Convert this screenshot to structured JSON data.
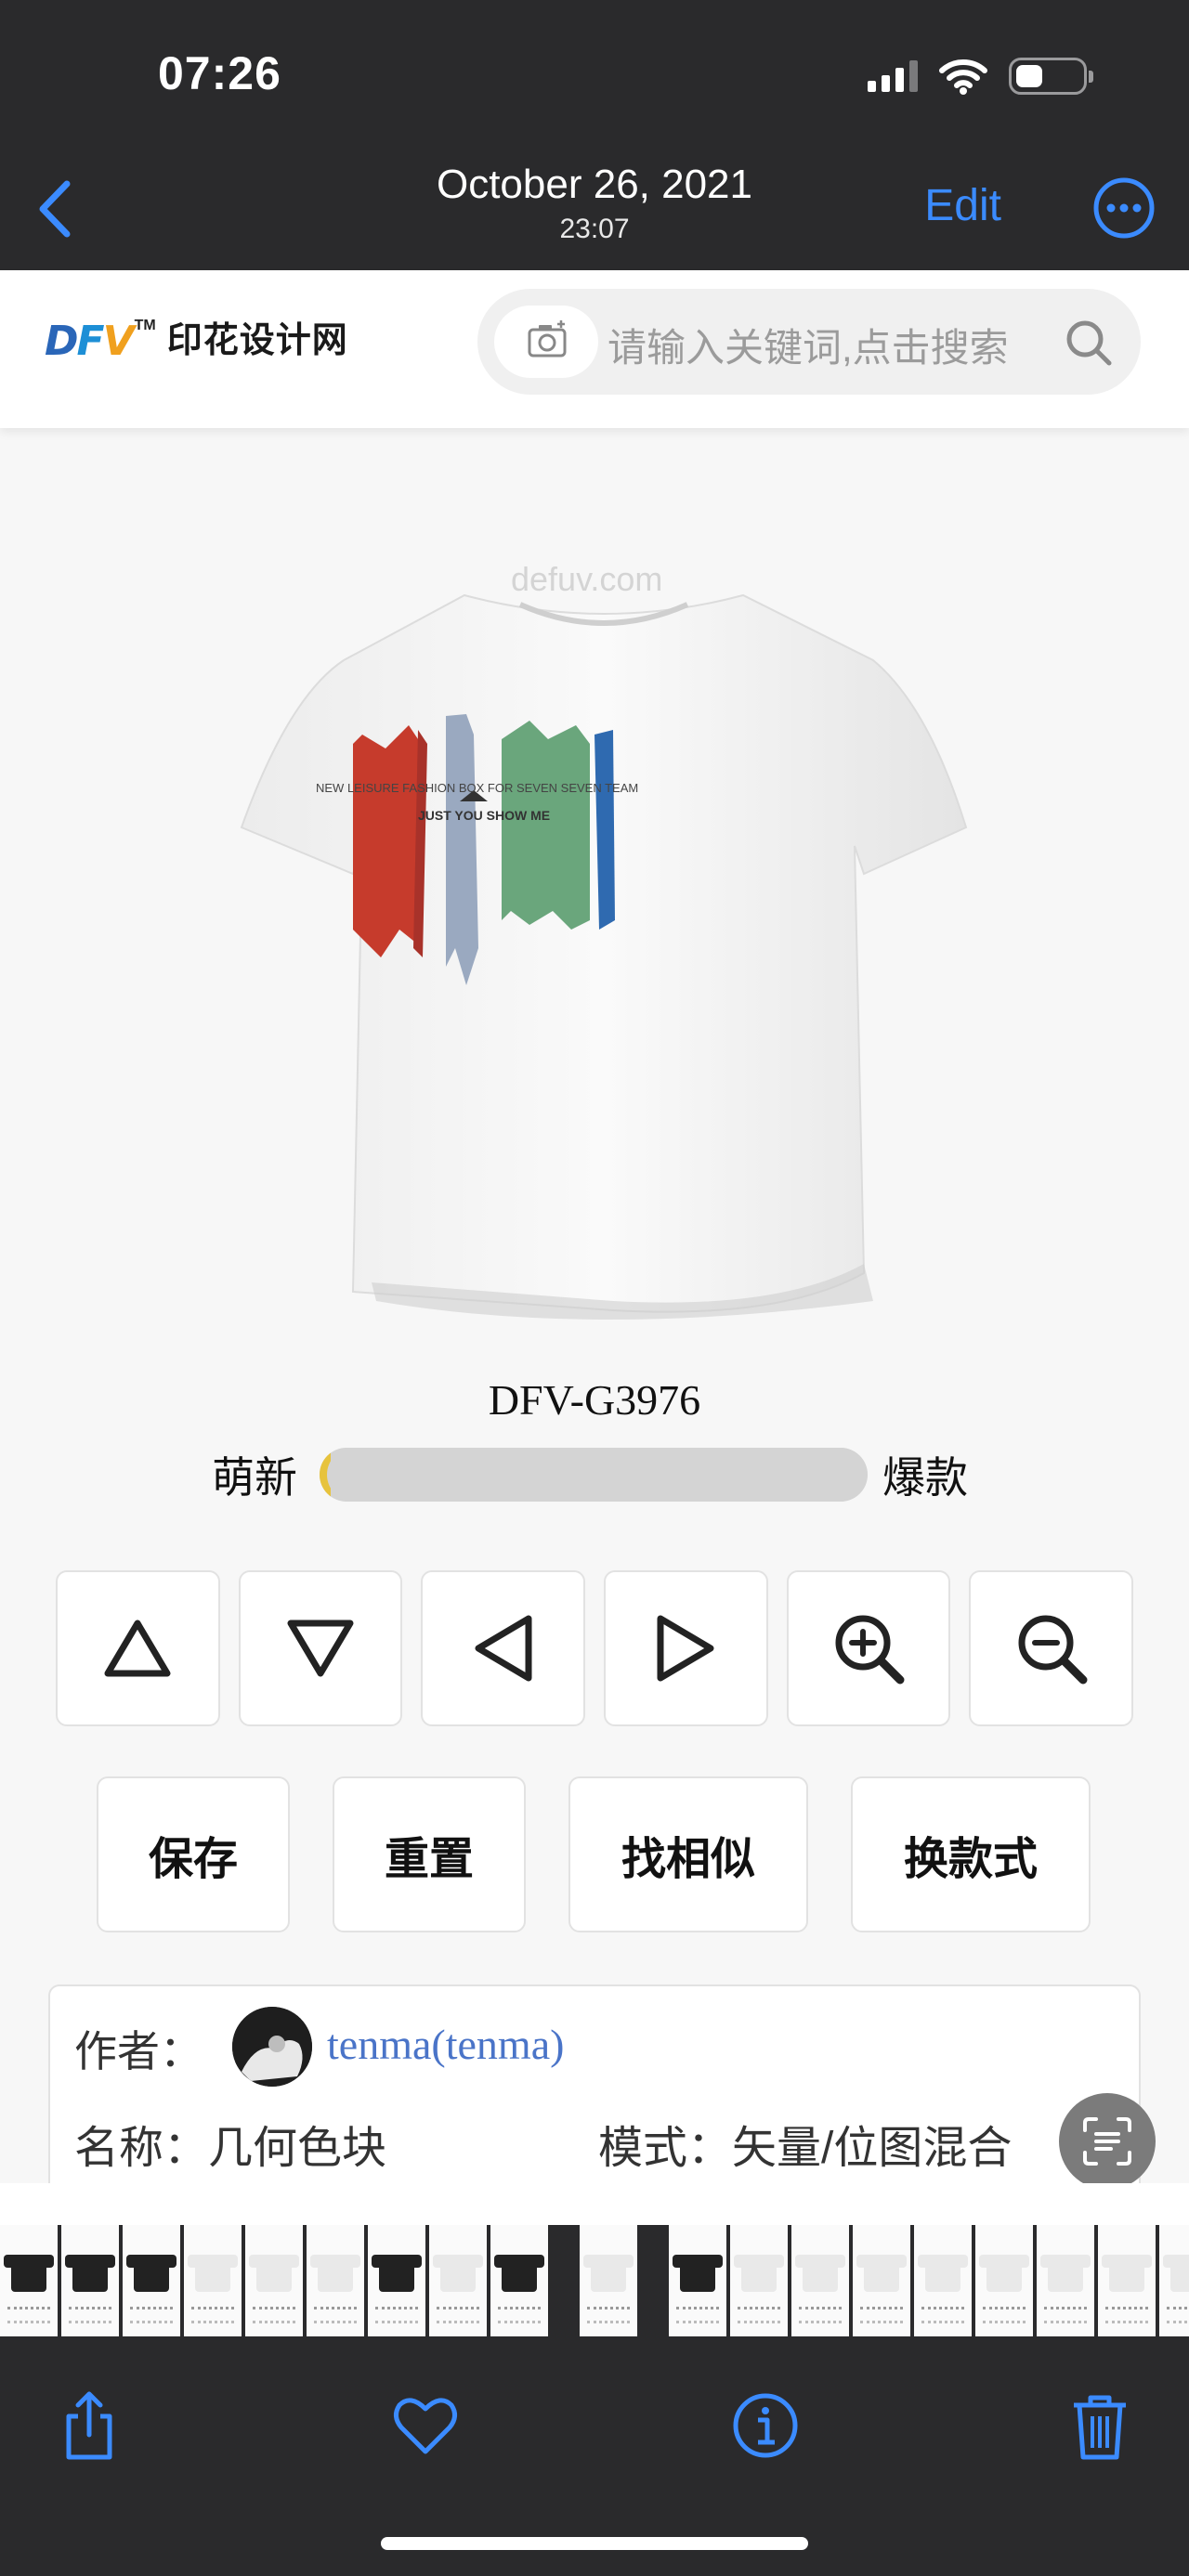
{
  "status_bar": {
    "time": "07:26"
  },
  "photo_nav": {
    "date": "October 26, 2021",
    "time": "23:07",
    "edit_label": "Edit",
    "accent_color": "#3b8bff"
  },
  "site": {
    "logo_brand": "DFV",
    "logo_tm": "TM",
    "logo_name": "印花设计网",
    "search_placeholder": "请输入关键词,点击搜索"
  },
  "product": {
    "watermark": "defuv.com",
    "print_line1": "NEW LEISURE FASHION BOX FOR SEVEN SEVEN TEAM",
    "print_line2": "JUST YOU SHOW ME",
    "code": "DFV-G3976",
    "rating_left": "萌新",
    "rating_right": "爆款",
    "rating_level": 0.02
  },
  "arrow_buttons": [
    {
      "name": "move-up-button",
      "icon": "triangle-up-icon"
    },
    {
      "name": "move-down-button",
      "icon": "triangle-down-icon"
    },
    {
      "name": "move-left-button",
      "icon": "triangle-left-icon"
    },
    {
      "name": "move-right-button",
      "icon": "triangle-right-icon"
    },
    {
      "name": "zoom-in-button",
      "icon": "zoom-in-icon"
    },
    {
      "name": "zoom-out-button",
      "icon": "zoom-out-icon"
    }
  ],
  "actions": {
    "save": "保存",
    "reset": "重置",
    "find_similar": "找相似",
    "change_style": "换款式"
  },
  "info": {
    "author_label": "作者：",
    "author_name": "tenma(tenma)",
    "name_label": "名称：几何色块",
    "mode_label": "模式：矢量/位图混合"
  }
}
